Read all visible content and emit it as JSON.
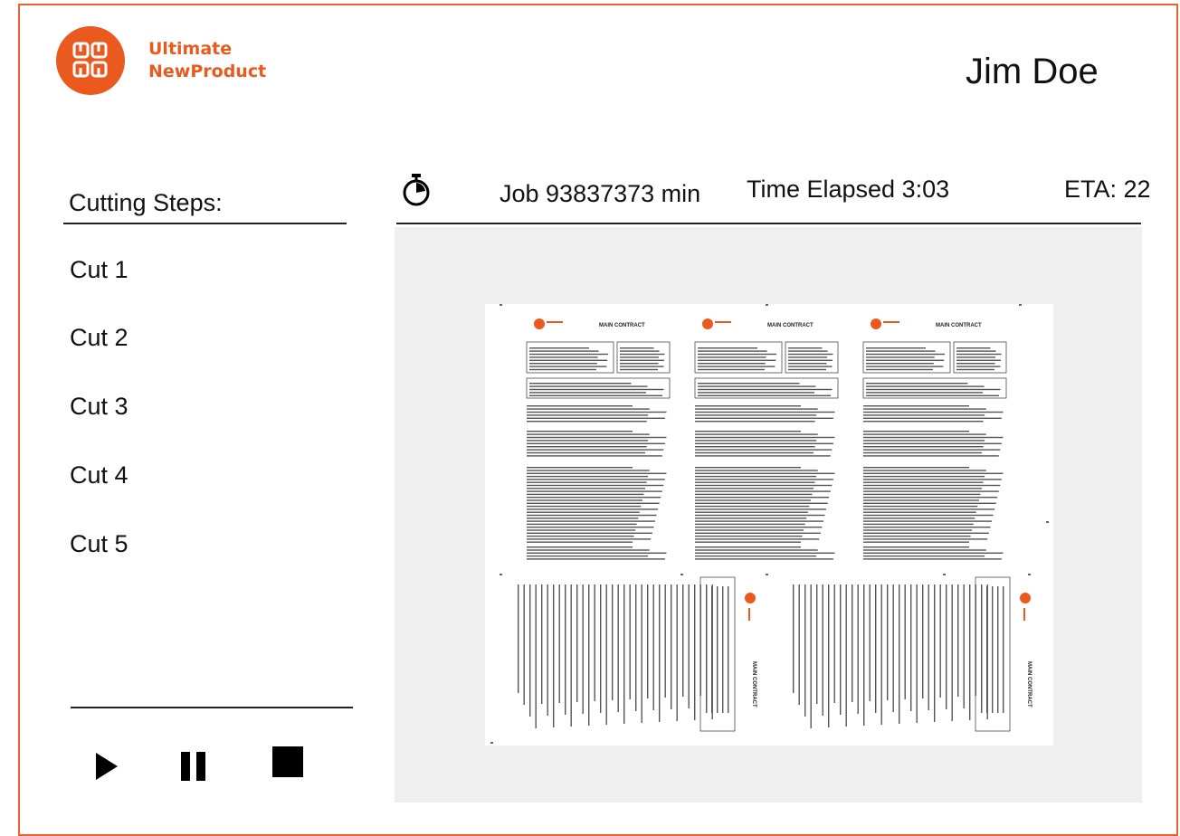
{
  "brand": {
    "line1": "Ultimate",
    "line2": "NewProduct",
    "accent_color": "#ea5a1f",
    "logo_icon": "grid-logo-icon"
  },
  "user": {
    "name": "Jim Doe"
  },
  "steps": {
    "title": "Cutting Steps:",
    "items": [
      "Cut 1",
      "Cut 2",
      "Cut 3",
      "Cut 4",
      "Cut 5"
    ]
  },
  "job": {
    "icon": "stopwatch-icon",
    "id_text": "Job 93837373 min",
    "elapsed_text": "Time Elapsed 3:03",
    "eta_text": "ETA: 22"
  },
  "preview": {
    "page_title": "MAIN CONTRACT",
    "layout": "3 upright pages on top row, 2 rotated pages on bottom row"
  },
  "controls": {
    "play_icon": "play-icon",
    "pause_icon": "pause-icon",
    "stop_icon": "stop-icon"
  }
}
